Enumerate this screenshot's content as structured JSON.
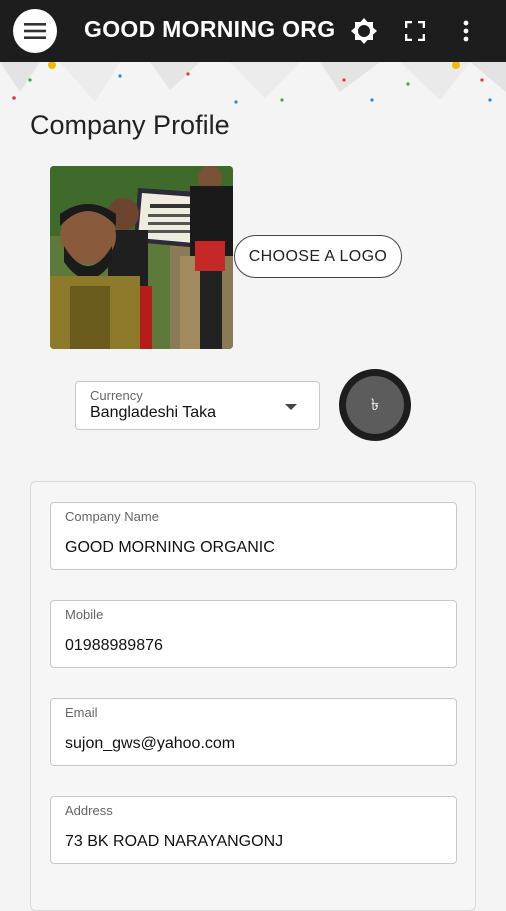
{
  "appbar": {
    "title": "GOOD MORNING ORG",
    "icons": [
      "menu-icon",
      "brightness-icon",
      "fullscreen-icon",
      "more-vert-icon"
    ]
  },
  "page": {
    "title": "Company Profile"
  },
  "logo": {
    "button_label": "CHOOSE A LOGO"
  },
  "currency": {
    "label": "Currency",
    "value": "Bangladeshi Taka",
    "symbol": "৳"
  },
  "form": {
    "company_name": {
      "label": "Company Name",
      "value": "GOOD MORNING ORGANIC"
    },
    "mobile": {
      "label": "Mobile",
      "value": "01988989876"
    },
    "email": {
      "label": "Email",
      "value": "sujon_gws@yahoo.com"
    },
    "address": {
      "label": "Address",
      "value": "73 BK ROAD NARAYANGONJ"
    }
  },
  "colors": {
    "appbar": "#1d1d1d",
    "background": "#f4f4f4",
    "symbol_bg": "#5c5c5c"
  }
}
